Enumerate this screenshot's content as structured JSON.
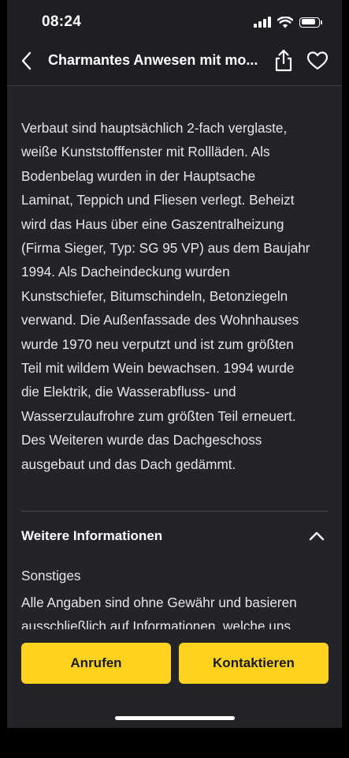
{
  "status_bar": {
    "time": "08:24",
    "icons": [
      "cellular-signal-icon",
      "wifi-icon",
      "battery-icon"
    ],
    "battery_level": 0.85
  },
  "nav": {
    "title": "Charmantes Anwesen mit mo...",
    "icons": [
      "chevron-left-icon",
      "share-icon",
      "heart-icon"
    ]
  },
  "content": {
    "description": "Verbaut sind hauptsächlich 2-fach verglaste,\nweiße Kunststofffenster mit Rollläden. Als\nBodenbelag wurden in der Hauptsache\nLaminat, Teppich und Fliesen verlegt. Beheizt\nwird das Haus über eine Gaszentralheizung\n(Firma Sieger, Typ: SG 95 VP) aus dem Baujahr\n1994. Als Dacheindeckung wurden\nKunstschiefer, Bitumschindeln, Betonziegeln\nverwand. Die Außenfassade des Wohnhauses\nwurde 1970 neu verputzt und ist zum größten\nTeil mit wildem Wein bewachsen. 1994 wurde\ndie Elektrik, die Wasserabfluss- und\nWasserzulaufrohre zum größten Teil erneuert.\nDes Weiteren wurde das Dachgeschoss\nausgebaut und das Dach gedämmt.",
    "section": {
      "title": "Weitere Informationen",
      "expanded": true,
      "label": "Sonstiges",
      "text": "Alle Angaben sind ohne Gewähr und basieren\nausschließlich auf Informationen, welche uns"
    }
  },
  "actions": {
    "call_label": "Anrufen",
    "contact_label": "Kontaktieren"
  },
  "colors": {
    "background": "#232328",
    "accent": "#ffd21f",
    "text": "#e6e6ea"
  }
}
